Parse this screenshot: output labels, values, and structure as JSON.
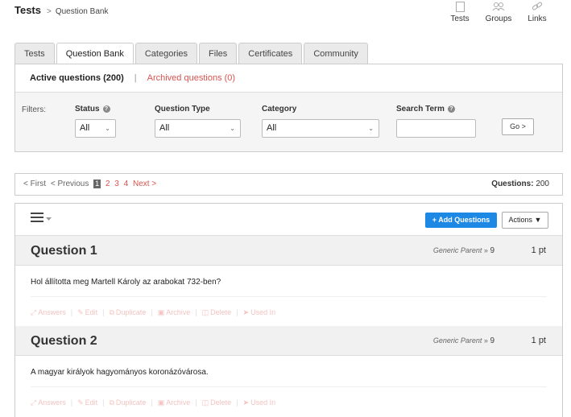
{
  "breadcrumb": {
    "root": "Tests",
    "separator": ">",
    "current": "Question Bank"
  },
  "topnav": [
    {
      "label": "Tests",
      "icon": "document-icon"
    },
    {
      "label": "Groups",
      "icon": "users-icon"
    },
    {
      "label": "Links",
      "icon": "link-icon"
    }
  ],
  "tabs": [
    "Tests",
    "Question Bank",
    "Categories",
    "Files",
    "Certificates",
    "Community"
  ],
  "active_tab": "Question Bank",
  "subtabs": {
    "active": "Active questions (200)",
    "separator": "|",
    "archived": "Archived questions (0)"
  },
  "filters": {
    "label": "Filters:",
    "status": {
      "title": "Status",
      "value": "All"
    },
    "question_type": {
      "title": "Question Type",
      "value": "All"
    },
    "category": {
      "title": "Category",
      "value": "All"
    },
    "search_term": {
      "title": "Search Term",
      "value": ""
    },
    "go_label": "Go >"
  },
  "pager": {
    "first": "< First",
    "previous": "< Previous",
    "current": "1",
    "pages": [
      "2",
      "3",
      "4"
    ],
    "next": "Next >"
  },
  "question_count": {
    "label": "Questions:",
    "value": "200"
  },
  "toolbar": {
    "add_label": "+ Add Questions",
    "actions_label": "Actions"
  },
  "questions": [
    {
      "title": "Question 1",
      "category": "Generic Parent",
      "category_sep": "»",
      "category_count": "9",
      "points": "1 pt",
      "text": "Hol állította meg Martell Károly az arabokat 732-ben?"
    },
    {
      "title": "Question 2",
      "category": "Generic Parent",
      "category_sep": "»",
      "category_count": "9",
      "points": "1 pt",
      "text": "A magyar királyok hagyományos koronázóvárosa."
    }
  ],
  "question_actions": [
    "Answers",
    "Edit",
    "Duplicate",
    "Archive",
    "Delete",
    "Used In"
  ],
  "colors": {
    "accent_blue": "#1e88e5",
    "link_red": "#d9534f",
    "faded_action": "#f3c4c1"
  }
}
